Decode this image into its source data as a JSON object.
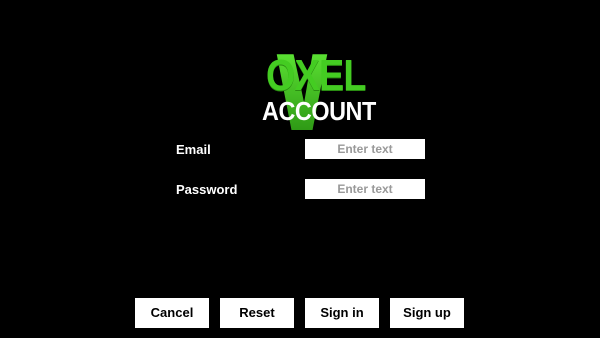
{
  "logo": {
    "letter": "V",
    "top_word": "OXEL",
    "bottom_word": "ACCOUNT",
    "colors": {
      "green": "#44cc22",
      "green_dark": "#2a8c12",
      "white": "#ffffff"
    }
  },
  "form": {
    "email": {
      "label": "Email",
      "placeholder": "Enter text",
      "value": ""
    },
    "password": {
      "label": "Password",
      "placeholder": "Enter text",
      "value": ""
    }
  },
  "buttons": {
    "cancel": "Cancel",
    "reset": "Reset",
    "sign_in": "Sign in",
    "sign_up": "Sign up"
  },
  "theme": {
    "background": "#000000",
    "text": "#ffffff",
    "button_bg": "#ffffff",
    "button_text": "#000000"
  }
}
